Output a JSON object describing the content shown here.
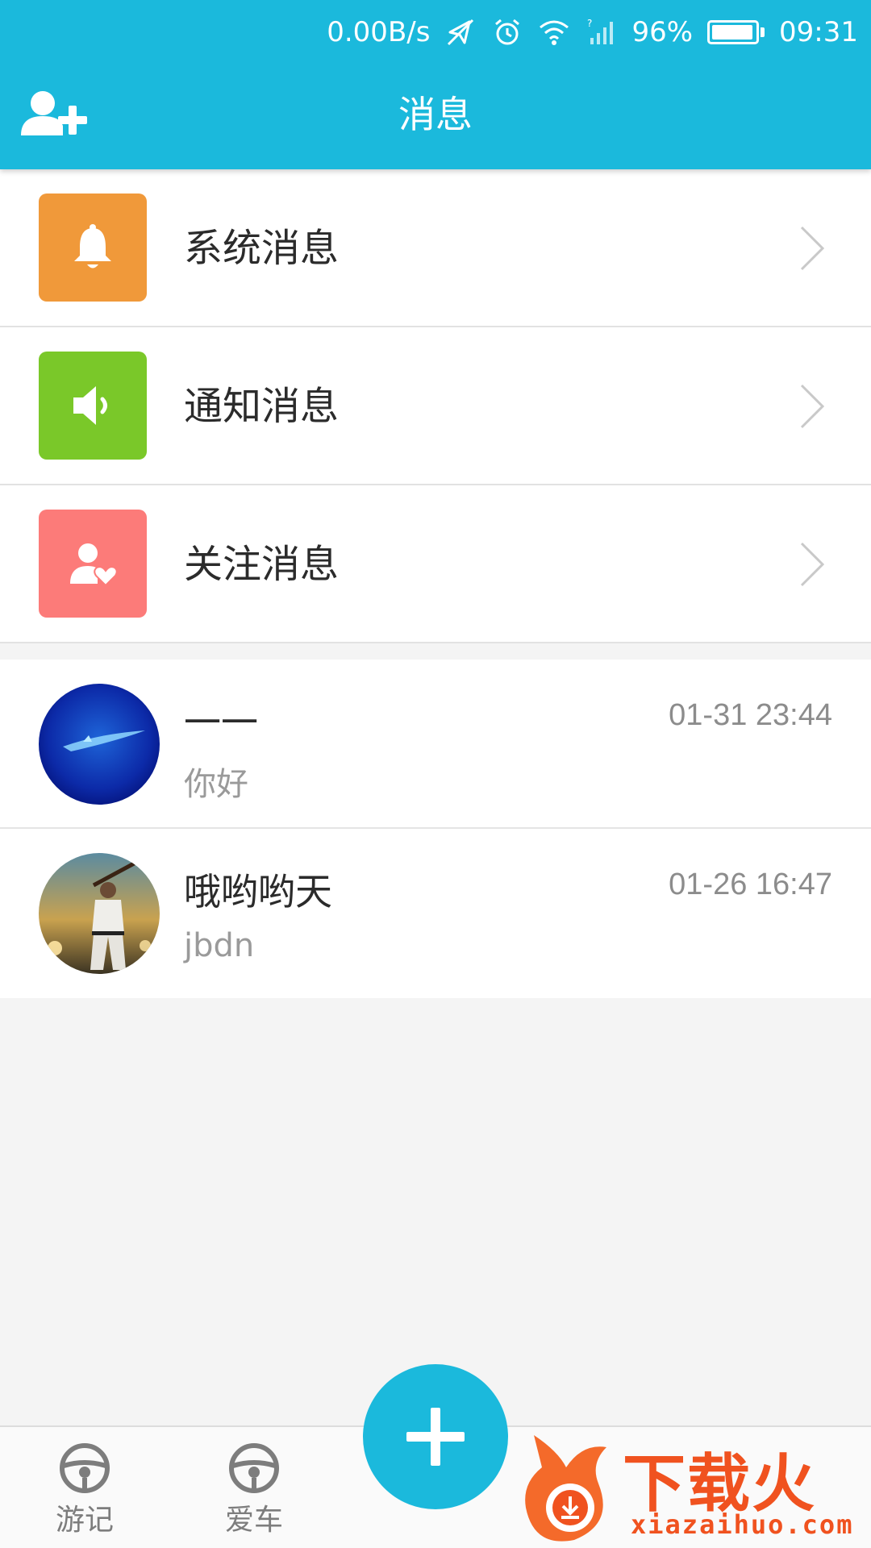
{
  "status": {
    "net_speed": "0.00B/s",
    "battery": "96%",
    "time": "09:31",
    "icons": [
      "mute-vibrate-icon",
      "alarm-icon",
      "wifi-icon",
      "signal-icon"
    ]
  },
  "header": {
    "title": "消息",
    "left_icon": "add-friend-icon",
    "color": "#1bb9dc"
  },
  "categories": [
    {
      "label": "系统消息",
      "icon": "bell-icon",
      "color": "#f0993a"
    },
    {
      "label": "通知消息",
      "icon": "speaker-icon",
      "color": "#7ac829"
    },
    {
      "label": "关注消息",
      "icon": "follow-heart-icon",
      "color": "#fc7b79"
    }
  ],
  "chats": [
    {
      "name": "一一",
      "time": "01-31 23:44",
      "preview": "你好",
      "avatar": "blue-underwater-avatar"
    },
    {
      "name": "哦哟哟天",
      "time": "01-26 16:47",
      "preview": "jbdn",
      "avatar": "baseball-player-avatar"
    }
  ],
  "bottom_nav": {
    "items": [
      {
        "label": "游记",
        "icon": "steering-wheel-icon"
      },
      {
        "label": "爱车",
        "icon": "steering-wheel-icon"
      }
    ],
    "fab_icon": "plus-icon"
  },
  "watermark": {
    "text": "下载火",
    "url": "xiazaihuo.com"
  }
}
